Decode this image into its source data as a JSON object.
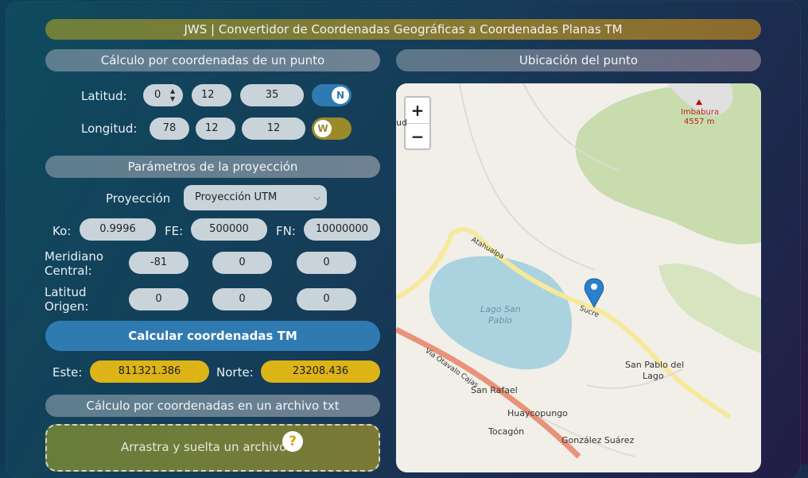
{
  "app": {
    "title": "JWS | Convertidor de Coordenadas Geográficas a Coordenadas Planas TM"
  },
  "point_section": {
    "title": "Cálculo por coordenadas de un punto"
  },
  "latitude": {
    "label": "Latitud:",
    "deg": "0",
    "min": "12",
    "sec": "35",
    "hemisphere": "N"
  },
  "longitude": {
    "label": "Longitud:",
    "deg": "78",
    "min": "12",
    "sec": "12",
    "hemisphere": "W"
  },
  "projection_section": {
    "title": "Parámetros de la proyección"
  },
  "projection": {
    "label": "Proyección",
    "selected": "Proyección UTM"
  },
  "params": {
    "ko_label": "Ko:",
    "ko": "0.9996",
    "fe_label": "FE:",
    "fe": "500000",
    "fn_label": "FN:",
    "fn": "10000000",
    "meridian_label_1": "Meridiano",
    "meridian_label_2": "Central:",
    "meridian_deg": "-81",
    "meridian_min": "0",
    "meridian_sec": "0",
    "origin_label_1": "Latitud",
    "origin_label_2": "Origen:",
    "origin_deg": "0",
    "origin_min": "0",
    "origin_sec": "0"
  },
  "calculate_button": "Calcular coordenadas TM",
  "results": {
    "east_label": "Este:",
    "east": "811321.386",
    "north_label": "Norte:",
    "north": "23208.436"
  },
  "file_section": {
    "title": "Cálculo por coordenadas en un archivo txt"
  },
  "dropzone": {
    "text": "Arrastra y suelta un archivo",
    "help_icon": "question-icon"
  },
  "map_section": {
    "title": "Ubicación del punto"
  },
  "map": {
    "zoom_in": "+",
    "zoom_out": "−",
    "labels": {
      "imbabura": "Imbabura",
      "imbabura_alt": "4557 m",
      "lake": "Lago San",
      "lake2": "Pablo",
      "sanpablo": "San Pablo del",
      "sanpablo2": "Lago",
      "sanrafael": "San Rafael",
      "huaycopungo": "Huaycopungo",
      "tocagon": "Tocagón",
      "gonzalez": "González Suárez",
      "atahualpa": "Atahualpa",
      "sucre": "Sucre",
      "via": "Via Otavalo Cajas",
      "ud": "ud"
    }
  }
}
